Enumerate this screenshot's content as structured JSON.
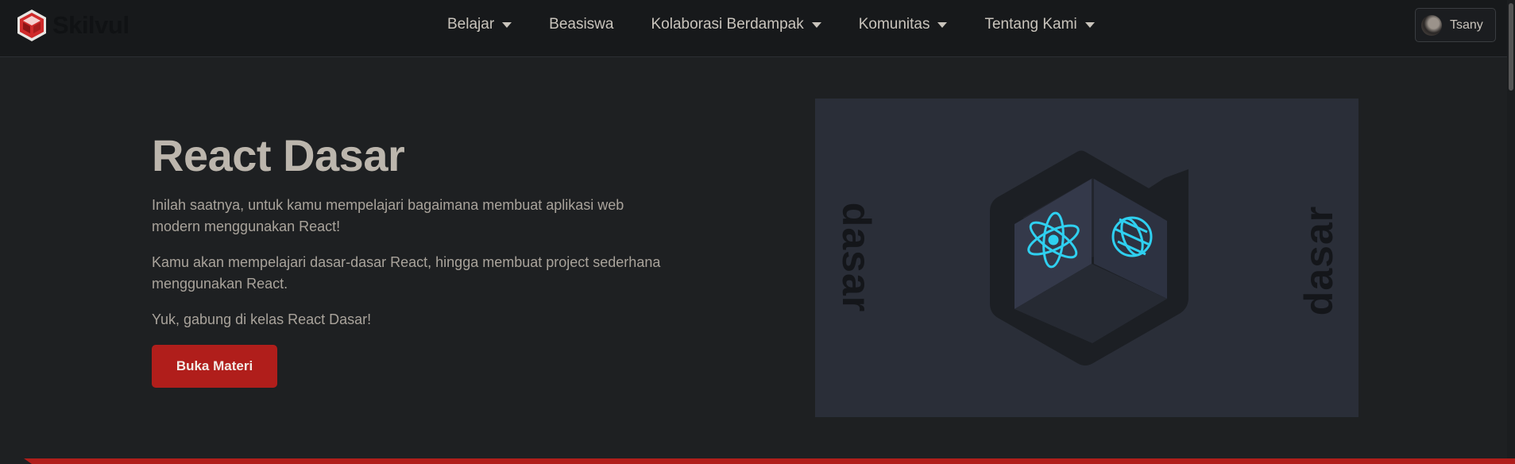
{
  "brand": {
    "name": "Skilvul"
  },
  "nav": {
    "items": [
      {
        "label": "Belajar",
        "dropdown": true
      },
      {
        "label": "Beasiswa",
        "dropdown": false
      },
      {
        "label": "Kolaborasi Berdampak",
        "dropdown": true
      },
      {
        "label": "Komunitas",
        "dropdown": true
      },
      {
        "label": "Tentang Kami",
        "dropdown": true
      }
    ]
  },
  "user": {
    "name": "Tsany"
  },
  "hero": {
    "title": "React Dasar",
    "paragraphs": [
      "Inilah saatnya, untuk kamu mempelajari bagaimana membuat aplikasi web modern menggunakan React!",
      "Kamu akan mempelajari dasar-dasar React, hingga membuat project sederhana menggunakan React.",
      "Yuk, gabung di kelas React Dasar!"
    ],
    "cta_label": "Buka Materi"
  },
  "artwork": {
    "side_word": "dasar",
    "icons": [
      "react-atom-icon",
      "globe-icon"
    ]
  },
  "colors": {
    "accent": "#b01e1b",
    "background": "#1e2022",
    "navbar": "#17191b",
    "artwork_bg": "#2a2e38",
    "icon_cyan": "#2fd0f0"
  }
}
